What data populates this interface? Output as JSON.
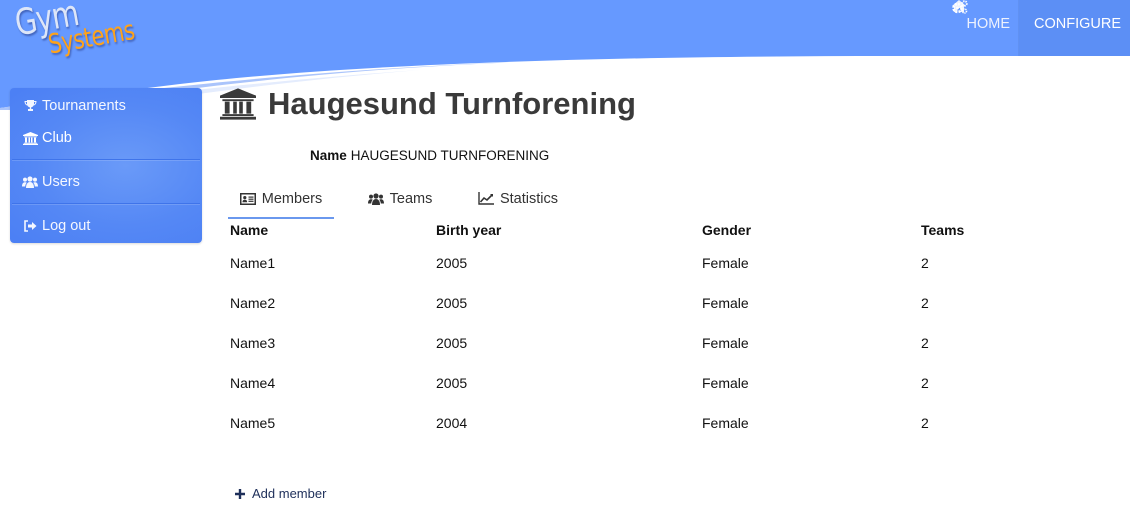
{
  "brand": {
    "line1": "Gym",
    "line2": "Systems"
  },
  "topnav": {
    "items": [
      {
        "label": "HOME",
        "icon": "home-icon",
        "active": false
      },
      {
        "label": "CONFIGURE",
        "icon": "cogs-icon",
        "active": true
      }
    ]
  },
  "sidebar": {
    "items": [
      {
        "label": "Tournaments",
        "icon": "trophy-icon"
      },
      {
        "label": "Club",
        "icon": "institution-icon",
        "active": true
      },
      {
        "label": "Users",
        "icon": "users-icon"
      },
      {
        "label": "Log out",
        "icon": "sign-out-icon"
      }
    ]
  },
  "page": {
    "title": "Haugesund Turnforening",
    "title_icon": "institution-icon",
    "name_label": "Name",
    "name_value": "HAUGESUND TURNFORENING"
  },
  "tabs": [
    {
      "label": "Members",
      "icon": "id-card-icon",
      "active": true
    },
    {
      "label": "Teams",
      "icon": "users-icon"
    },
    {
      "label": "Statistics",
      "icon": "line-chart-icon"
    }
  ],
  "table": {
    "headers": [
      "Name",
      "Birth year",
      "Gender",
      "Teams"
    ],
    "rows": [
      [
        "Name1",
        "2005",
        "Female",
        "2"
      ],
      [
        "Name2",
        "2005",
        "Female",
        "2"
      ],
      [
        "Name3",
        "2005",
        "Female",
        "2"
      ],
      [
        "Name4",
        "2005",
        "Female",
        "2"
      ],
      [
        "Name5",
        "2004",
        "Female",
        "2"
      ]
    ]
  },
  "actions": {
    "add_member": "Add member"
  },
  "colors": {
    "header_blue": "#6699ff",
    "sidebar_blue": "#5588f5",
    "logo_orange": "#ffa31a",
    "tab_underline": "#6a98ee"
  }
}
